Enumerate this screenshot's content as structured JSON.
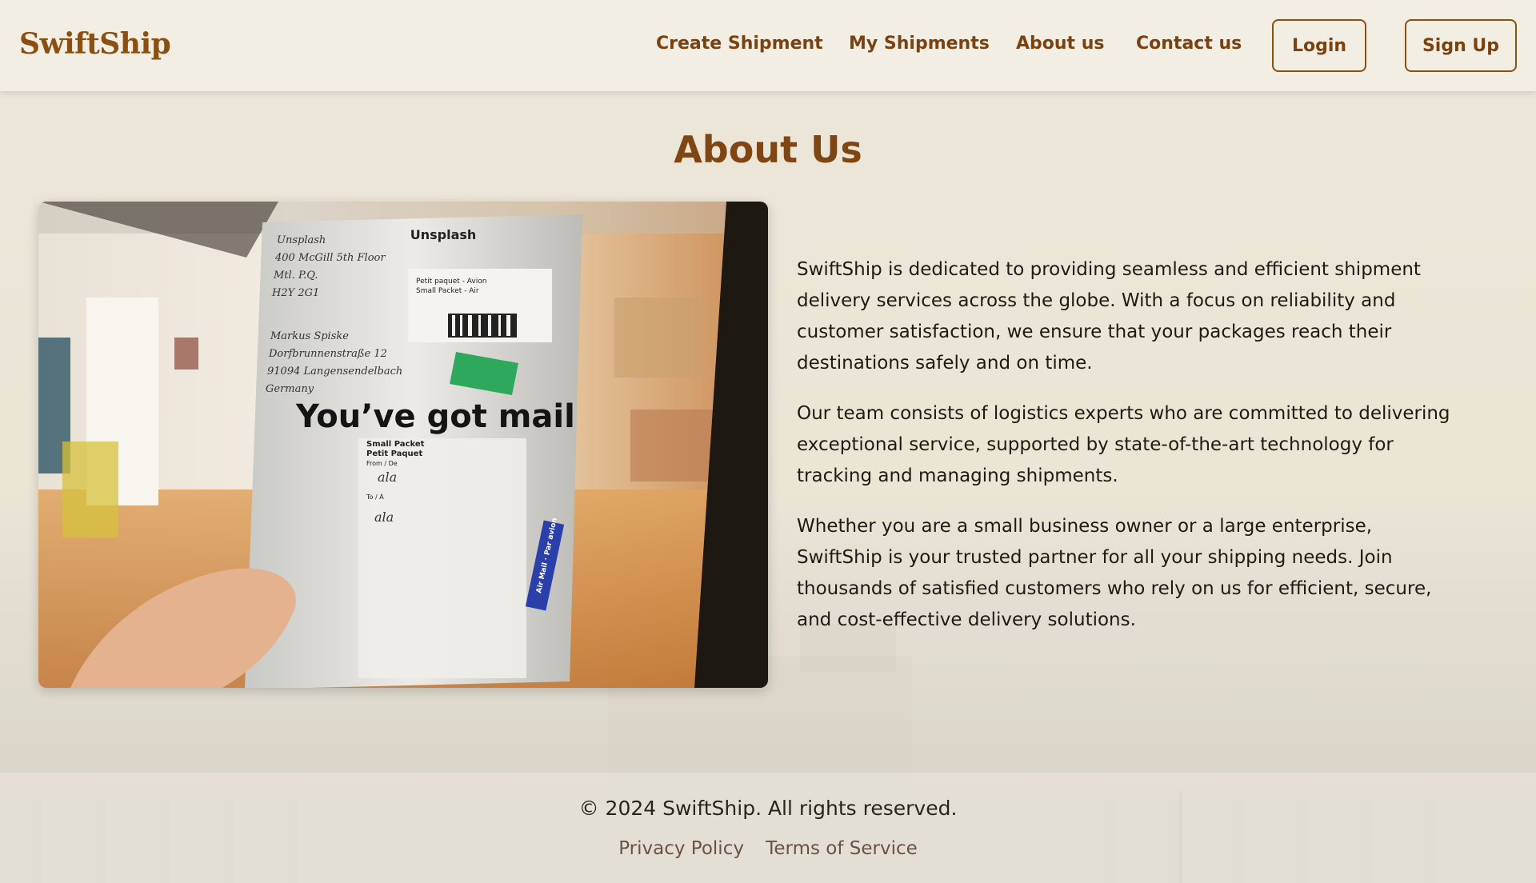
{
  "header": {
    "logo": "SwiftShip",
    "nav": [
      "Create Shipment",
      "My Shipments",
      "About us",
      "Contact us"
    ],
    "login_label": "Login",
    "signup_label": "Sign Up"
  },
  "main": {
    "title": "About Us",
    "paragraphs": [
      "SwiftShip is dedicated to providing seamless and efficient shipment delivery services across the globe. With a focus on reliability and customer satisfaction, we ensure that your packages reach their destinations safely and on time.",
      "Our team consists of logistics experts who are committed to delivering exceptional service, supported by state-of-the-art technology for tracking and managing shipments.",
      "Whether you are a small business owner or a large enterprise, SwiftShip is your trusted partner for all your shipping needs. Join thousands of satisfied customers who rely on us for efficient, secure, and cost-effective delivery solutions."
    ],
    "photo": {
      "package_brand": "Unsplash",
      "headline": "You’ve got mail",
      "label_title": "Petit paquet - Avion",
      "label_subtitle": "Small Packet - Air",
      "packet_text_1": "Small Packet",
      "packet_text_2": "Petit Paquet",
      "from_label": "From / De",
      "to_label": "To / À",
      "handwritten_from": "ala",
      "handwritten_to": "ala",
      "sticker_text": "Air Mail · Par avion",
      "address_lines": [
        "Unsplash",
        "400 McGill 5th Floor",
        "Mtl. P.Q.",
        "H2Y 2G1",
        "Markus Spiske",
        "Dorfbrunnenstraße 12",
        "91094 Langensendelbach",
        "Germany"
      ]
    }
  },
  "footer": {
    "copyright": "© 2024 SwiftShip. All rights reserved.",
    "privacy_label": "Privacy Policy",
    "terms_label": "Terms of Service"
  },
  "colors": {
    "brand": "#8b4f12",
    "header_bg": "#f3eee3",
    "page_bg": "#ece6d9"
  }
}
